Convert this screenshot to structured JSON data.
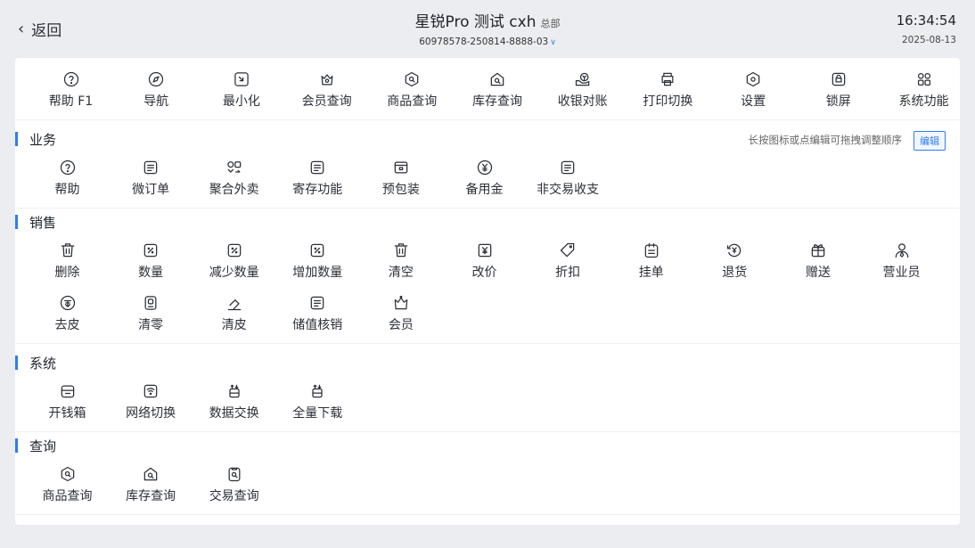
{
  "header": {
    "back_label": "返回",
    "title": "星锐Pro 测试 cxh",
    "title_tag": "总部",
    "subtitle": "60978578-250814-8888-03",
    "time": "16:34:54",
    "date": "2025-08-13"
  },
  "toolbar": [
    {
      "label": "帮助 F1",
      "icon": "help-icon"
    },
    {
      "label": "导航",
      "icon": "compass-icon"
    },
    {
      "label": "最小化",
      "icon": "minimize-icon"
    },
    {
      "label": "会员查询",
      "icon": "member-query-icon"
    },
    {
      "label": "商品查询",
      "icon": "product-query-icon"
    },
    {
      "label": "库存查询",
      "icon": "stock-query-icon"
    },
    {
      "label": "收银对账",
      "icon": "reconcile-icon"
    },
    {
      "label": "打印切换",
      "icon": "printer-icon"
    },
    {
      "label": "设置",
      "icon": "settings-icon"
    },
    {
      "label": "锁屏",
      "icon": "lock-screen-icon"
    },
    {
      "label": "系统功能",
      "icon": "apps-icon"
    }
  ],
  "hint": "长按图标或点编辑可拖拽调整顺序",
  "edit_label": "编辑",
  "sections": [
    {
      "title": "业务",
      "items": [
        {
          "label": "帮助",
          "icon": "help-icon"
        },
        {
          "label": "微订单",
          "icon": "order-icon"
        },
        {
          "label": "聚合外卖",
          "icon": "delivery-icon"
        },
        {
          "label": "寄存功能",
          "icon": "storage-icon"
        },
        {
          "label": "预包装",
          "icon": "package-icon"
        },
        {
          "label": "备用金",
          "icon": "cash-icon"
        },
        {
          "label": "非交易收支",
          "icon": "ledger-icon"
        }
      ]
    },
    {
      "title": "销售",
      "items": [
        {
          "label": "删除",
          "icon": "trash-icon"
        },
        {
          "label": "数量",
          "icon": "quantity-icon"
        },
        {
          "label": "减少数量",
          "icon": "decrease-icon"
        },
        {
          "label": "增加数量",
          "icon": "increase-icon"
        },
        {
          "label": "清空",
          "icon": "clear-icon"
        },
        {
          "label": "改价",
          "icon": "price-icon"
        },
        {
          "label": "折扣",
          "icon": "tag-icon"
        },
        {
          "label": "挂单",
          "icon": "hold-order-icon"
        },
        {
          "label": "退货",
          "icon": "refund-icon"
        },
        {
          "label": "赠送",
          "icon": "gift-icon"
        },
        {
          "label": "营业员",
          "icon": "clerk-icon"
        },
        {
          "label": "去皮",
          "icon": "tare-icon"
        },
        {
          "label": "清零",
          "icon": "zero-icon"
        },
        {
          "label": "清皮",
          "icon": "eraser-icon"
        },
        {
          "label": "储值核销",
          "icon": "stored-value-icon"
        },
        {
          "label": "会员",
          "icon": "crown-icon"
        }
      ]
    },
    {
      "title": "系统",
      "items": [
        {
          "label": "开钱箱",
          "icon": "cash-drawer-icon"
        },
        {
          "label": "网络切换",
          "icon": "wifi-switch-icon"
        },
        {
          "label": "数据交换",
          "icon": "data-exchange-icon"
        },
        {
          "label": "全量下载",
          "icon": "download-icon"
        }
      ]
    },
    {
      "title": "查询",
      "items": [
        {
          "label": "商品查询",
          "icon": "product-query-icon"
        },
        {
          "label": "库存查询",
          "icon": "stock-query-icon"
        },
        {
          "label": "交易查询",
          "icon": "transaction-query-icon"
        }
      ]
    }
  ]
}
